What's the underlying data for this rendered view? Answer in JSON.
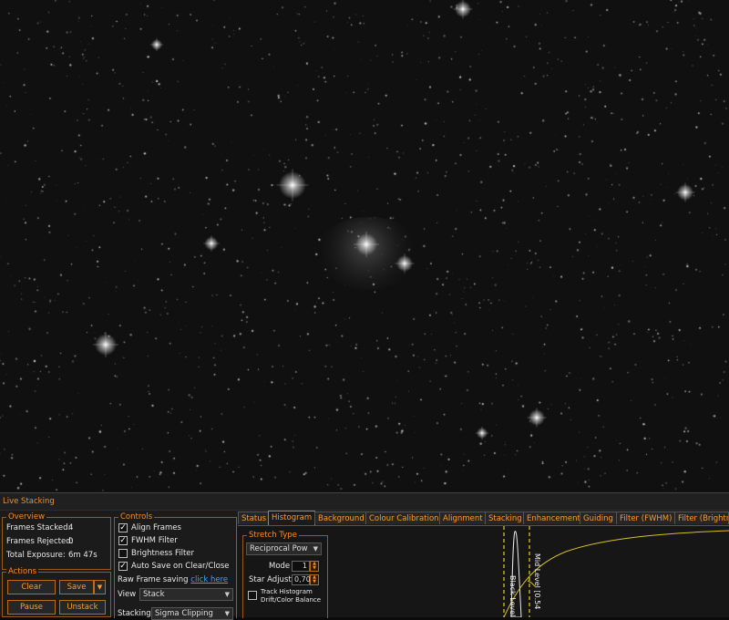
{
  "window": {
    "title": "Live Stacking"
  },
  "overview": {
    "title": "Overview",
    "frames_stacked_label": "Frames Stacked:",
    "frames_stacked": "4",
    "frames_rejected_label": "Frames Rejected:",
    "frames_rejected": "0",
    "total_exposure_label": "Total Exposure:",
    "total_exposure": "6m 47s"
  },
  "actions": {
    "title": "Actions",
    "clear": "Clear",
    "save": "Save",
    "pause": "Pause",
    "unstack": "Unstack"
  },
  "controls": {
    "title": "Controls",
    "align_frames": {
      "label": "Align Frames",
      "checked": true
    },
    "fwhm_filter": {
      "label": "FWHM Filter",
      "checked": true
    },
    "brightness_filter": {
      "label": "Brightness Filter",
      "checked": false
    },
    "auto_save": {
      "label": "Auto Save on Clear/Close",
      "checked": true
    },
    "raw_frame_label": "Raw Frame saving",
    "raw_frame_link": "click here",
    "view_label": "View",
    "view_value": "Stack",
    "stacking_label": "Stacking",
    "stacking_value": "Sigma Clipping"
  },
  "tabs": [
    "Status",
    "Histogram",
    "Background",
    "Colour Calibration",
    "Alignment",
    "Stacking",
    "Enhancement",
    "Guiding",
    "Filter (FWHM)",
    "Filter (Brightne"
  ],
  "active_tab": "Histogram",
  "histogram": {
    "stretch_title": "Stretch Type",
    "stretch_value": "Reciprocal Pow",
    "mode_label": "Mode",
    "mode_value": "1",
    "star_adjust_label": "Star Adjust",
    "star_adjust_value": "0,70",
    "track_histogram_label": "Track Histogram",
    "drift_label": "Drift/Color Balance",
    "black_level_label": "Black Level",
    "mid_level_label": "Mid Level [0.54"
  },
  "colors": {
    "accent": "#ff8c1a",
    "border": "#9a5a16",
    "link": "#3aa0ff",
    "curve": "#d8c020"
  }
}
